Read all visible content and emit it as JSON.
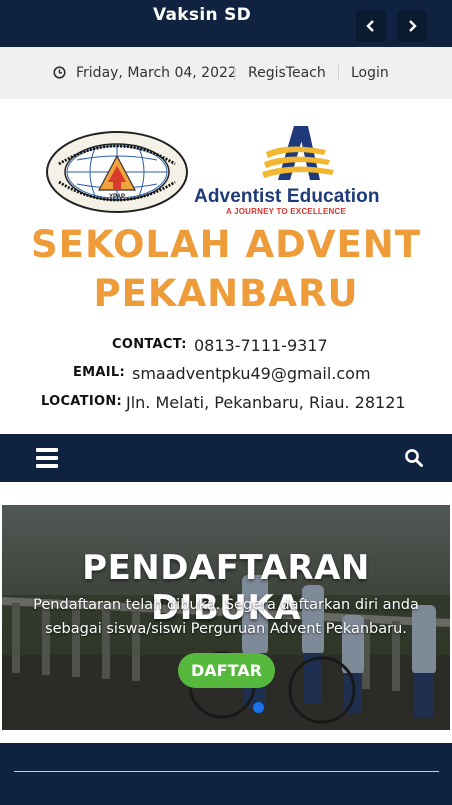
{
  "ticker": {
    "text": "Vaksin SD",
    "prev_icon": "chevron-left-icon",
    "next_icon": "chevron-right-icon"
  },
  "topbar": {
    "date_icon": "clock-icon",
    "date": "Friday, March 04, 2022",
    "links": [
      "RegisTeach",
      "Login"
    ]
  },
  "header": {
    "logos": {
      "ypap_text": "PERGURUAN ADVENT PEKANBARU (YPAP) · Jl. Melati 49, Pekanbaru 28121, Riau",
      "ypap_center": "YPAP",
      "ae_name": "Adventist Education",
      "ae_tagline": "A JOURNEY TO EXCELLENCE"
    },
    "title_line1": "SEKOLAH ADVENT",
    "title_line2": "PEKANBARU",
    "contact": {
      "contact_label": "CONTACT:",
      "contact_value": "0813-7111-9317",
      "email_label": "EMAIL:",
      "email_value": "smaadventpku49@gmail.com",
      "location_label": "LOCATION:",
      "location_value": "Jln. Melati, Pekanbaru, Riau. 28121"
    }
  },
  "navbar": {
    "menu_icon": "hamburger-menu-icon",
    "search_icon": "search-icon"
  },
  "slider": {
    "title": "PENDAFTARAN DIBUKA",
    "description": "Pendaftaran telah dibuka. Segera daftarkan diri anda sebagai siswa/siswi Perguruan Advent Pekanbaru.",
    "button": "DAFTAR"
  },
  "colors": {
    "navy": "#0f2340",
    "orange_title": "#ee9b3a",
    "button_green": "#56b83c",
    "dot_blue": "#1a73e8"
  }
}
